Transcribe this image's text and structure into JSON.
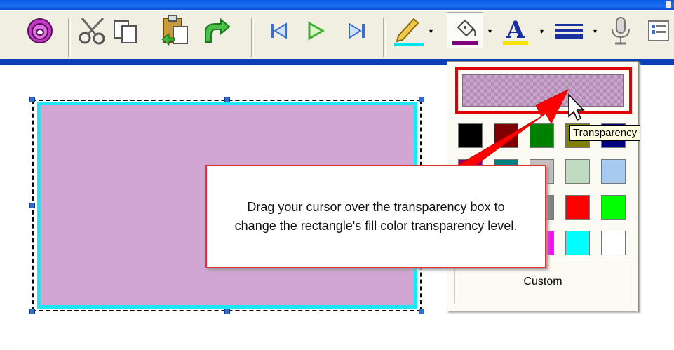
{
  "window": {
    "title_bar_color": "#0a5be6"
  },
  "toolbar": {
    "buttons": [
      {
        "icon": "snap-icon"
      },
      {
        "icon": "cut-icon"
      },
      {
        "icon": "copy-icon"
      },
      {
        "icon": "paste-icon"
      },
      {
        "icon": "undo-icon"
      },
      {
        "icon": "skip-back-icon"
      },
      {
        "icon": "play-icon"
      },
      {
        "icon": "skip-forward-icon"
      },
      {
        "icon": "line-color-icon",
        "accent": "#00e5f0"
      },
      {
        "icon": "fill-color-icon",
        "accent": "#800080"
      },
      {
        "icon": "font-color-icon",
        "accent": "#f5e400"
      },
      {
        "icon": "line-style-icon"
      },
      {
        "icon": "microphone-icon"
      },
      {
        "icon": "properties-icon"
      }
    ],
    "dropdown_arrow": "▾"
  },
  "canvas": {
    "shape": "rectangle",
    "fill_color": "#d2a6d3",
    "border_color": "#1ee6f5"
  },
  "palette": {
    "transparency_preview_color": "#b48db8",
    "swatches": [
      [
        "#000000",
        "#800000",
        "#008000",
        "#808000",
        "#000080"
      ],
      [
        "#800080",
        "#008080",
        "#c0c0c0",
        "#c0dcc0",
        "#a6caf0"
      ],
      [
        "#808080",
        "#ff8080",
        "#808080",
        "#ff0000",
        "#00ff00"
      ],
      [
        "#0000ff",
        "#ffff00",
        "#ff00ff",
        "#00ffff",
        "#ffffff"
      ]
    ],
    "custom_label": "Custom"
  },
  "tooltip": {
    "text": "Transparency"
  },
  "callout": {
    "text": "Drag your cursor over the transparency box to change the rectangle's fill color transparency level.",
    "border_color": "#e03030"
  },
  "annotation": {
    "arrow_color": "#ff0000"
  }
}
